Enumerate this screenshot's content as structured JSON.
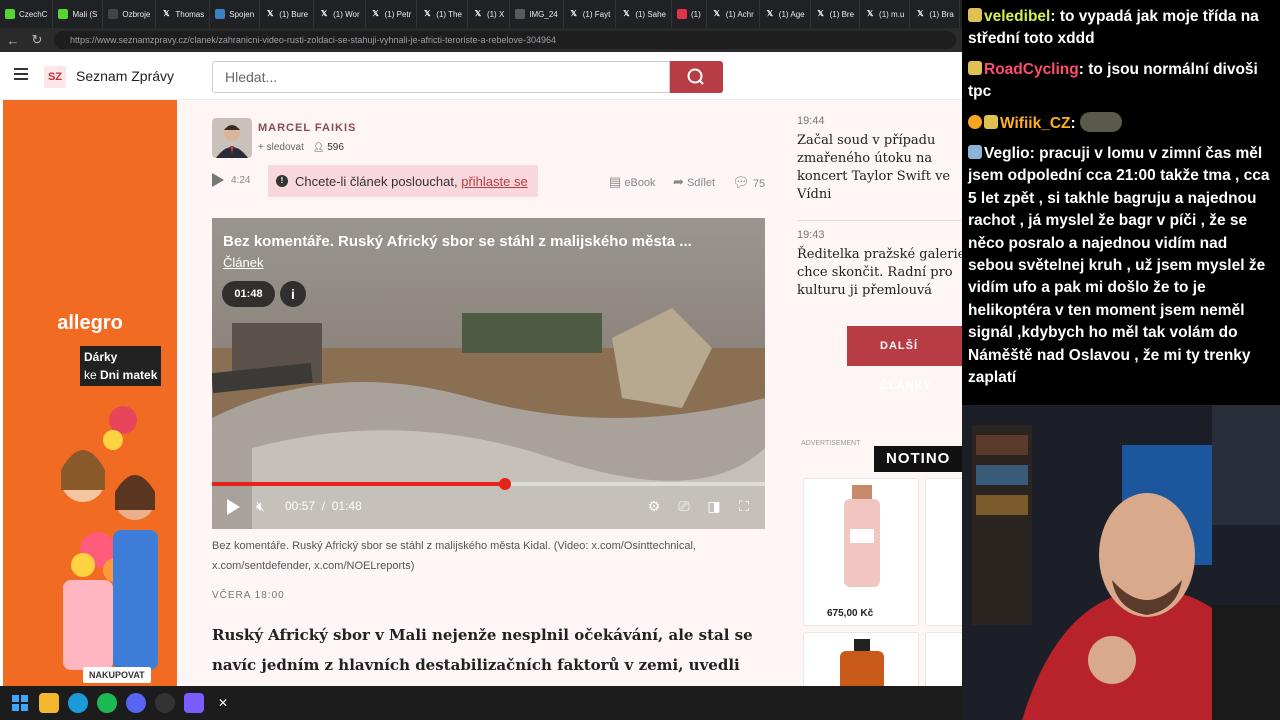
{
  "browser": {
    "tabs": [
      {
        "label": "CzechC",
        "icon": "k-icon",
        "color": "#53d62f"
      },
      {
        "label": "Mali (S",
        "icon": "leaf-icon",
        "color": "#53d62f"
      },
      {
        "label": "Ozbroje",
        "icon": "sz-icon",
        "color": "#444444"
      },
      {
        "label": "Thomas",
        "icon": "x-icon",
        "color": "#202124"
      },
      {
        "label": "Spojen",
        "icon": "m-icon",
        "color": "#3b82c4"
      },
      {
        "label": "(1) Bure",
        "icon": "x-icon",
        "color": "#202124"
      },
      {
        "label": "(1) Wor",
        "icon": "x-icon",
        "color": "#202124"
      },
      {
        "label": "(1) Petr",
        "icon": "x-icon",
        "color": "#202124"
      },
      {
        "label": "(1) The",
        "icon": "x-icon",
        "color": "#202124"
      },
      {
        "label": "(1) X",
        "icon": "x-icon",
        "color": "#202124"
      },
      {
        "label": "IMG_24",
        "icon": "globe-icon",
        "color": "#5a5a5a"
      },
      {
        "label": "(1) Fayt",
        "icon": "x-icon",
        "color": "#202124"
      },
      {
        "label": "(1) Sahe",
        "icon": "x-icon",
        "color": "#202124"
      },
      {
        "label": "(1)",
        "icon": "red-dot-icon",
        "color": "#e0344a"
      },
      {
        "label": "(1) Achr",
        "icon": "x-icon",
        "color": "#202124"
      },
      {
        "label": "(1) Age",
        "icon": "x-icon",
        "color": "#202124"
      },
      {
        "label": "(1) Bre",
        "icon": "x-icon",
        "color": "#202124"
      },
      {
        "label": "(1) m.u",
        "icon": "x-icon",
        "color": "#202124"
      },
      {
        "label": "(1) Bra",
        "icon": "x-icon",
        "color": "#202124"
      }
    ],
    "url": "https://www.seznamzpravy.cz/clanek/zahranicni-video-rusti-zoldaci-se-stahuji-vyhnali-je-africti-teroriste-a-rebelove-304964"
  },
  "site": {
    "logo": "SZ",
    "brand": "Seznam Zprávy",
    "search_placeholder": "Hledat...",
    "accent": "#b83c44"
  },
  "ad_left": {
    "brand": "allegro",
    "promo_line1": "Dárky",
    "promo_line2_pre": "ke ",
    "promo_line2_bold": "Dni matek",
    "cta": "NAKUPOVAT"
  },
  "article": {
    "author": "MARCEL FAIKIS",
    "follow": "+ sledovat",
    "followers": "596",
    "audio_duration": "4:24",
    "listen_text": "Chcete-li článek poslouchat,",
    "listen_link": "přihlaste se",
    "ebook": "eBook",
    "share": "Sdílet",
    "comments": "75",
    "video": {
      "title": "Bez komentáře. Ruský Africký sbor se stáhl z malijského města ...",
      "link": "Článek",
      "duration_badge": "01:48",
      "current_time": "00:57",
      "separator": "/",
      "total_time": "01:48",
      "progress": 0.53
    },
    "caption": "Bez komentáře. Ruský Africký sbor se stáhl z malijského města Kidal.  (Video: x.com/Osinttechnical, x.com/sentdefender, x.com/NOELreports)",
    "date": "VČERA 18:00",
    "lead": "Ruský Africký sbor v Mali nejenže nesplnil očekávání, ale stal se navíc jedním z hlavních destabilizačních faktorů v zemi, uvedli už dříve"
  },
  "sidebar": {
    "items": [
      {
        "time": "19:44",
        "headline": "Začal soud v případu zmařeného útoku na koncert Taylor Swift ve Vídni"
      },
      {
        "time": "19:43",
        "headline": "Ředitelka pražské galerie chce skončit. Radní pro kulturu ji přemlouvá"
      }
    ],
    "more_button": "DALŠÍ ČLÁNKY",
    "ad_label": "ADVERTISEMENT",
    "ad_brand": "NOTINO",
    "product_price": "675,00 Kč"
  },
  "chat": {
    "messages": [
      {
        "user": "veledibel",
        "user_color": "#d4f04a",
        "text": "to vypadá jak moje třída na střední toto xddd"
      },
      {
        "user": "RoadCycling",
        "user_color": "#ff4d6a",
        "text": "to jsou normální divoši tpc"
      },
      {
        "user": "Wifiik_CZ",
        "user_color": "#ffb020",
        "text": ""
      },
      {
        "user": "Veglio",
        "user_color": "#ffffff",
        "text": "pracuji v lomu v zimní čas měl jsem odpolední cca 21:00 takže tma , cca 5 let zpět , si takhle bagruju a najednou rachot , já myslel že bagr v píči , že se něco posralo a najednou vidím nad sebou světelnej kruh , už jsem myslel že vidím ufo a pak mi došlo že to je helikoptéra v ten moment jsem neměl signál ,kdybych ho měl tak volám do Náměště nad Oslavou , že mi ty trenky zaplatí"
      }
    ]
  },
  "taskbar": {
    "apps": [
      "windows-start-icon",
      "file-explorer-icon",
      "edge-icon",
      "spotify-icon",
      "discord-icon",
      "obs-icon",
      "copilot-icon",
      "x-app-icon"
    ]
  }
}
